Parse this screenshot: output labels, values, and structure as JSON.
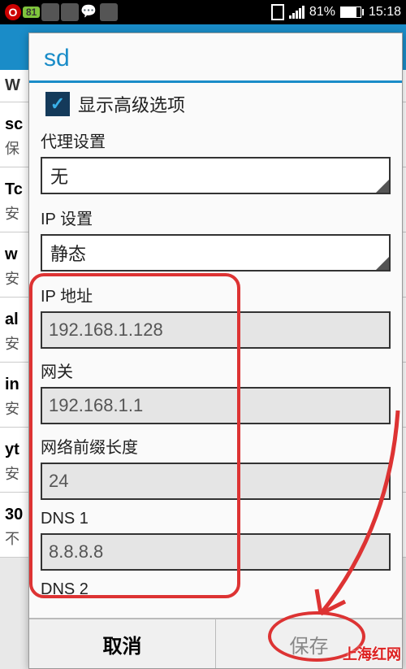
{
  "status": {
    "qq_count": "81",
    "battery_pct": "81%",
    "time": "15:18"
  },
  "bg": {
    "tab": "W",
    "items": [
      {
        "t": "sc",
        "s": "保"
      },
      {
        "t": "Tc",
        "s": "安"
      },
      {
        "t": "w",
        "s": "安"
      },
      {
        "t": "al",
        "s": "安"
      },
      {
        "t": "in",
        "s": "安"
      },
      {
        "t": "yt",
        "s": "安"
      },
      {
        "t": "30",
        "s": "不"
      }
    ]
  },
  "dialog": {
    "title": "sd",
    "advanced_label": "显示高级选项",
    "proxy_label": "代理设置",
    "proxy_value": "无",
    "ip_settings_label": "IP 设置",
    "ip_settings_value": "静态",
    "ip_addr_label": "IP 地址",
    "ip_addr_value": "192.168.1.128",
    "gateway_label": "网关",
    "gateway_value": "192.168.1.1",
    "prefix_label": "网络前缀长度",
    "prefix_value": "24",
    "dns1_label": "DNS 1",
    "dns1_value": "8.8.8.8",
    "dns2_label": "DNS 2",
    "cancel": "取消",
    "save": "保存"
  },
  "watermark": "上海红网"
}
